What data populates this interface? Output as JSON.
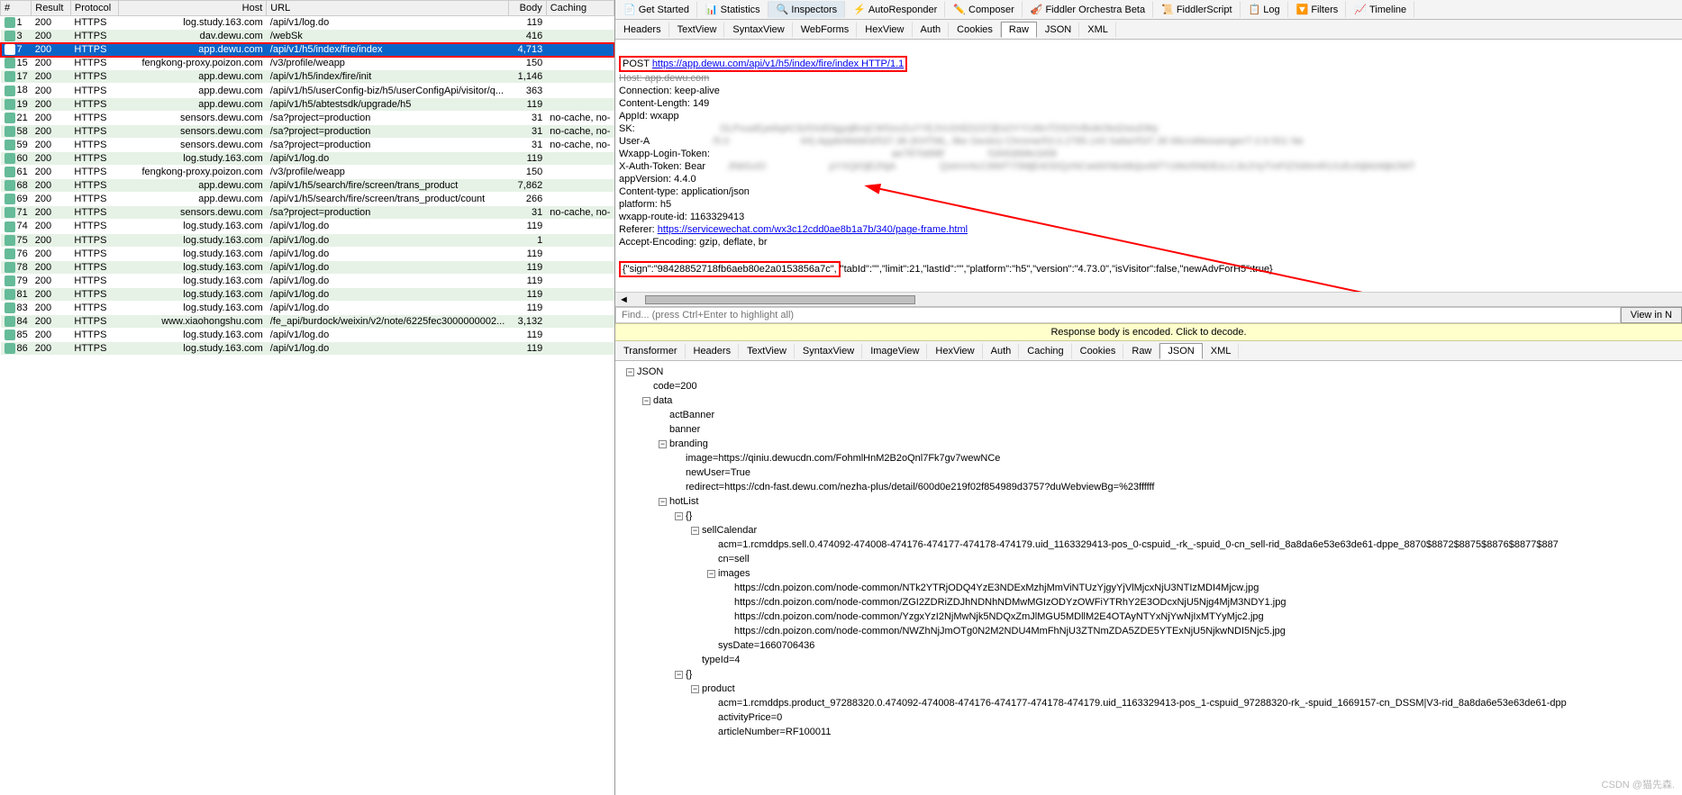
{
  "columns": {
    "num": "#",
    "result": "Result",
    "protocol": "Protocol",
    "host": "Host",
    "url": "URL",
    "body": "Body",
    "caching": "Caching"
  },
  "sessions": [
    {
      "n": "1",
      "r": "200",
      "p": "HTTPS",
      "h": "log.study.163.com",
      "u": "/api/v1/log.do",
      "b": "119",
      "c": "",
      "even": false
    },
    {
      "n": "3",
      "r": "200",
      "p": "HTTPS",
      "h": "dav.dewu.com",
      "u": "/webSk",
      "b": "416",
      "c": "",
      "even": true
    },
    {
      "n": "7",
      "r": "200",
      "p": "HTTPS",
      "h": "app.dewu.com",
      "u": "/api/v1/h5/index/fire/index",
      "b": "4,713",
      "c": "",
      "even": true,
      "sel": true
    },
    {
      "n": "15",
      "r": "200",
      "p": "HTTPS",
      "h": "fengkong-proxy.poizon.com",
      "u": "/v3/profile/weapp",
      "b": "150",
      "c": "",
      "even": false
    },
    {
      "n": "17",
      "r": "200",
      "p": "HTTPS",
      "h": "app.dewu.com",
      "u": "/api/v1/h5/index/fire/init",
      "b": "1,146",
      "c": "",
      "even": true
    },
    {
      "n": "18",
      "r": "200",
      "p": "HTTPS",
      "h": "app.dewu.com",
      "u": "/api/v1/h5/userConfig-biz/h5/userConfigApi/visitor/q...",
      "b": "363",
      "c": "",
      "even": false
    },
    {
      "n": "19",
      "r": "200",
      "p": "HTTPS",
      "h": "app.dewu.com",
      "u": "/api/v1/h5/abtestsdk/upgrade/h5",
      "b": "119",
      "c": "",
      "even": true
    },
    {
      "n": "21",
      "r": "200",
      "p": "HTTPS",
      "h": "sensors.dewu.com",
      "u": "/sa?project=production",
      "b": "31",
      "c": "no-cache, no-",
      "even": false
    },
    {
      "n": "58",
      "r": "200",
      "p": "HTTPS",
      "h": "sensors.dewu.com",
      "u": "/sa?project=production",
      "b": "31",
      "c": "no-cache, no-",
      "even": true
    },
    {
      "n": "59",
      "r": "200",
      "p": "HTTPS",
      "h": "sensors.dewu.com",
      "u": "/sa?project=production",
      "b": "31",
      "c": "no-cache, no-",
      "even": false
    },
    {
      "n": "60",
      "r": "200",
      "p": "HTTPS",
      "h": "log.study.163.com",
      "u": "/api/v1/log.do",
      "b": "119",
      "c": "",
      "even": true
    },
    {
      "n": "61",
      "r": "200",
      "p": "HTTPS",
      "h": "fengkong-proxy.poizon.com",
      "u": "/v3/profile/weapp",
      "b": "150",
      "c": "",
      "even": false
    },
    {
      "n": "68",
      "r": "200",
      "p": "HTTPS",
      "h": "app.dewu.com",
      "u": "/api/v1/h5/search/fire/screen/trans_product",
      "b": "7,862",
      "c": "",
      "even": true
    },
    {
      "n": "69",
      "r": "200",
      "p": "HTTPS",
      "h": "app.dewu.com",
      "u": "/api/v1/h5/search/fire/screen/trans_product/count",
      "b": "266",
      "c": "",
      "even": false
    },
    {
      "n": "71",
      "r": "200",
      "p": "HTTPS",
      "h": "sensors.dewu.com",
      "u": "/sa?project=production",
      "b": "31",
      "c": "no-cache, no-",
      "even": true
    },
    {
      "n": "74",
      "r": "200",
      "p": "HTTPS",
      "h": "log.study.163.com",
      "u": "/api/v1/log.do",
      "b": "119",
      "c": "",
      "even": false
    },
    {
      "n": "75",
      "r": "200",
      "p": "HTTPS",
      "h": "log.study.163.com",
      "u": "/api/v1/log.do",
      "b": "1",
      "c": "",
      "even": true
    },
    {
      "n": "76",
      "r": "200",
      "p": "HTTPS",
      "h": "log.study.163.com",
      "u": "/api/v1/log.do",
      "b": "119",
      "c": "",
      "even": false
    },
    {
      "n": "78",
      "r": "200",
      "p": "HTTPS",
      "h": "log.study.163.com",
      "u": "/api/v1/log.do",
      "b": "119",
      "c": "",
      "even": true
    },
    {
      "n": "79",
      "r": "200",
      "p": "HTTPS",
      "h": "log.study.163.com",
      "u": "/api/v1/log.do",
      "b": "119",
      "c": "",
      "even": false
    },
    {
      "n": "81",
      "r": "200",
      "p": "HTTPS",
      "h": "log.study.163.com",
      "u": "/api/v1/log.do",
      "b": "119",
      "c": "",
      "even": true
    },
    {
      "n": "83",
      "r": "200",
      "p": "HTTPS",
      "h": "log.study.163.com",
      "u": "/api/v1/log.do",
      "b": "119",
      "c": "",
      "even": false
    },
    {
      "n": "84",
      "r": "200",
      "p": "HTTPS",
      "h": "www.xiaohongshu.com",
      "u": "/fe_api/burdock/weixin/v2/note/6225fec3000000002...",
      "b": "3,132",
      "c": "",
      "even": true
    },
    {
      "n": "85",
      "r": "200",
      "p": "HTTPS",
      "h": "log.study.163.com",
      "u": "/api/v1/log.do",
      "b": "119",
      "c": "",
      "even": false
    },
    {
      "n": "86",
      "r": "200",
      "p": "HTTPS",
      "h": "log.study.163.com",
      "u": "/api/v1/log.do",
      "b": "119",
      "c": "",
      "even": true
    }
  ],
  "toolbar": [
    "Get Started",
    "Statistics",
    "Inspectors",
    "AutoResponder",
    "Composer",
    "Fiddler Orchestra Beta",
    "FiddlerScript",
    "Log",
    "Filters",
    "Timeline"
  ],
  "toolbar_active": 2,
  "reqTabs": [
    "Headers",
    "TextView",
    "SyntaxView",
    "WebForms",
    "HexView",
    "Auth",
    "Cookies",
    "Raw",
    "JSON",
    "XML"
  ],
  "reqTab_active": 7,
  "raw": {
    "line1a": "POST ",
    "line1b": "https://app.dewu.com/api/v1/h5/index/fire/index HTTP/1.1",
    "host": "Host: app.dewu.com",
    "conn": "Connection: keep-alive",
    "clen": "Content-Length: 149",
    "appid": "AppId: wxapp",
    "sk": "SK: ",
    "sk_blur": "                              DLPxueEye6qACitz5XdGtgyqBmjCWSovZuYYEJVv3XED237jEsOYYUI6nTDSOVBxikOksDsiuD9iy",
    "ua": "User-A",
    "ua_blur": "                       /5.0                          64) AppleWebKit/537.36 (KHTML, like Gecko) Chrome/53.0.2785.143 Safari/537.36 MicroMessenger/7.0.9.501 Ne",
    "wlt": "Wxapp-Login-Token: ",
    "wlt_blur": "                                                                 ae7870d98f                f1840|6bfe1b58",
    "xat": "X-Auth-Token: Bear",
    "xat_blur": "        JhbGciO                       pYXQiOjE2NjA                QsImV4cCI6MTY5MjE4ODQzNCwidXNlcklkIjoxMTYzMzI5NDEzLCJic2VyTmFtZSI6ImR1XzExNjMzMjkOMT",
    "av": "appVersion: 4.4.0",
    "ct": "Content-type: application/json",
    "pf": "platform: h5",
    "wri": "wxapp-route-id: 1163329413",
    "refa": "Referer: ",
    "refb": "https://servicewechat.com/wx3c12cdd0ae8b1a7b/340/page-frame.html",
    "ae": "Accept-Encoding: gzip, deflate, br",
    "body1": "{\"sign\":\"98428852718fb6aeb80e2a0153856a7c\",",
    "body2": "\"tabId\":\"\",\"limit\":21,\"lastId\":\"\",\"platform\":\"h5\",\"version\":\"4.73.0\",\"isVisitor\":false,\"newAdvForH5\":true}"
  },
  "find_ph": "Find... (press Ctrl+Enter to highlight all)",
  "find_btn": "View in N",
  "yellow": "Response body is encoded. Click to decode.",
  "respTabs": [
    "Transformer",
    "Headers",
    "TextView",
    "SyntaxView",
    "ImageView",
    "HexView",
    "Auth",
    "Caching",
    "Cookies",
    "Raw",
    "JSON",
    "XML"
  ],
  "respTab_active": 10,
  "tree": [
    {
      "l": 0,
      "t": "JSON",
      "e": "-"
    },
    {
      "l": 1,
      "t": "code=200"
    },
    {
      "l": 1,
      "t": "data",
      "e": "-"
    },
    {
      "l": 2,
      "t": "actBanner"
    },
    {
      "l": 2,
      "t": "banner"
    },
    {
      "l": 2,
      "t": "branding",
      "e": "-"
    },
    {
      "l": 3,
      "t": "image=https://qiniu.dewucdn.com/FohmlHnM2B2oQnl7Fk7gv7wewNCe"
    },
    {
      "l": 3,
      "t": "newUser=True"
    },
    {
      "l": 3,
      "t": "redirect=https://cdn-fast.dewu.com/nezha-plus/detail/600d0e219f02f854989d3757?duWebviewBg=%23ffffff"
    },
    {
      "l": 2,
      "t": "hotList",
      "e": "-"
    },
    {
      "l": 3,
      "t": "{}",
      "e": "-"
    },
    {
      "l": 4,
      "t": "sellCalendar",
      "e": "-"
    },
    {
      "l": 5,
      "t": "acm=1.rcmddps.sell.0.474092-474008-474176-474177-474178-474179.uid_1163329413-pos_0-cspuid_-rk_-spuid_0-cn_sell-rid_8a8da6e53e63de61-dppe_8870$8872$8875$8876$8877$887"
    },
    {
      "l": 5,
      "t": "cn=sell"
    },
    {
      "l": 5,
      "t": "images",
      "e": "-"
    },
    {
      "l": 6,
      "t": "https://cdn.poizon.com/node-common/NTk2YTRjODQ4YzE3NDExMzhjMmViNTUzYjgyYjVlMjcxNjU3NTIzMDI4Mjcw.jpg"
    },
    {
      "l": 6,
      "t": "https://cdn.poizon.com/node-common/ZGI2ZDRiZDJhNDNhNDMwMGIzODYzOWFiYTRhY2E3ODcxNjU5Njg4MjM3NDY1.jpg"
    },
    {
      "l": 6,
      "t": "https://cdn.poizon.com/node-common/YzgxYzI2NjMwNjk5NDQxZmJlMGU5MDllM2E4OTAyNTYxNjYwNjIxMTYyMjc2.jpg"
    },
    {
      "l": 6,
      "t": "https://cdn.poizon.com/node-common/NWZhNjJmOTg0N2M2NDU4MmFhNjU3ZTNmZDA5ZDE5YTExNjU5NjkwNDI5Njc5.jpg"
    },
    {
      "l": 5,
      "t": "sysDate=1660706436"
    },
    {
      "l": 4,
      "t": "typeId=4"
    },
    {
      "l": 3,
      "t": "{}",
      "e": "-"
    },
    {
      "l": 4,
      "t": "product",
      "e": "-"
    },
    {
      "l": 5,
      "t": "acm=1.rcmddps.product_97288320.0.474092-474008-474176-474177-474178-474179.uid_1163329413-pos_1-cspuid_97288320-rk_-spuid_1669157-cn_DSSM|V3-rid_8a8da6e53e63de61-dpp"
    },
    {
      "l": 5,
      "t": "activityPrice=0"
    },
    {
      "l": 5,
      "t": "articleNumber=RF100011"
    }
  ],
  "sign_label": "sign",
  "credit": "CSDN @猫先森."
}
